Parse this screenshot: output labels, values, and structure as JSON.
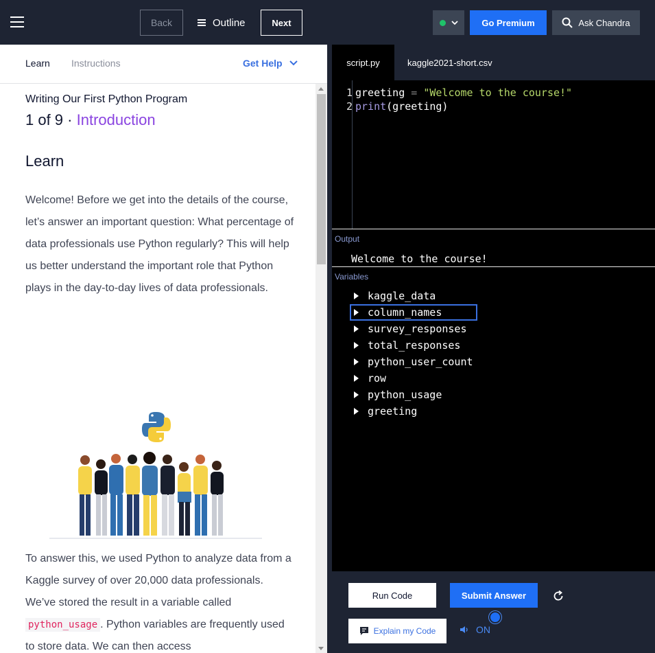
{
  "topbar": {
    "back_label": "Back",
    "outline_label": "Outline",
    "next_label": "Next",
    "premium_label": "Go Premium",
    "ask_label": "Ask Chandra",
    "status_color": "#1fc26a"
  },
  "left": {
    "tabs": {
      "learn": "Learn",
      "instructions": "Instructions",
      "get_help": "Get Help"
    },
    "lesson_title": "Writing Our First Python Program",
    "lesson_step_prefix": "1 of 9 ·",
    "lesson_step_name": "Introduction",
    "learn_heading": "Learn",
    "para1": "Welcome! Before we get into the details of the course, let’s answer an important question: What percentage of data professionals use Python regularly? This will help us better understand the important role that Python plays in the day-to-day lives of data professionals.",
    "para2_a": "To answer this, we used Python to analyze data from a Kaggle survey of over 20,000 data professionals. We’ve stored the result in a variable called",
    "para2_code": "python_usage",
    "para2_b": ". Python variables are frequently used to store data. We can then access"
  },
  "right": {
    "file_tabs": [
      "script.py",
      "kaggle2021-short.csv"
    ],
    "line_numbers": [
      "1",
      "2"
    ],
    "code": {
      "l1_var": "greeting",
      "l1_op": " = ",
      "l1_str": "\"Welcome to the course!\"",
      "l2_fn": "print",
      "l2_rest": "(greeting)"
    },
    "output_label": "Output",
    "output_text": "Welcome to the course!",
    "variables_label": "Variables",
    "variables": [
      "kaggle_data",
      "column_names",
      "survey_responses",
      "total_responses",
      "python_user_count",
      "row",
      "python_usage",
      "greeting"
    ],
    "selected_variable_index": 1,
    "run_label": "Run Code",
    "submit_label": "Submit Answer",
    "explain_label": "Explain my Code",
    "sound_label": "ON"
  }
}
